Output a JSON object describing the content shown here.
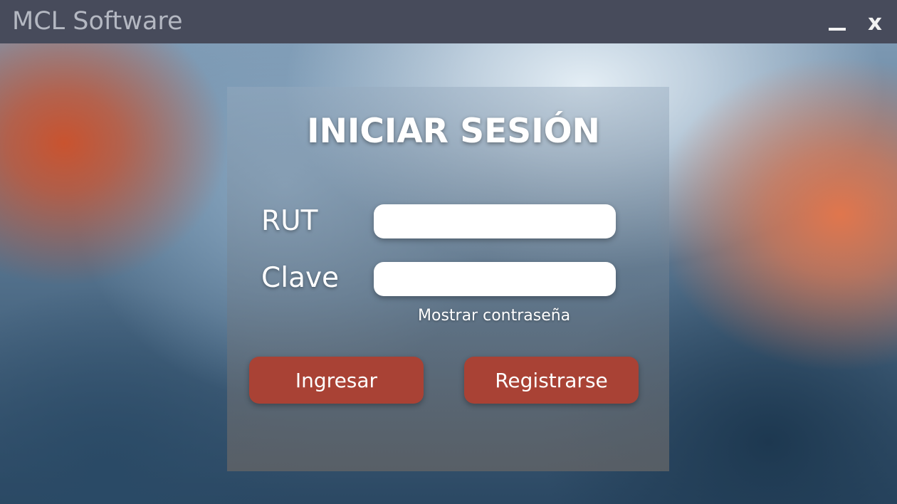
{
  "window": {
    "title": "MCL Software",
    "minimize_icon": "minimize-icon",
    "close_label": "x"
  },
  "login": {
    "heading": "INICIAR SESIÓN",
    "rut_label": "RUT",
    "rut_value": "",
    "password_label": "Clave",
    "password_value": "",
    "show_password_label": "Mostrar contraseña",
    "login_button_label": "Ingresar",
    "register_button_label": "Registrarse"
  },
  "colors": {
    "titlebar": "#474b5b",
    "button_accent": "#a94235",
    "panel_text": "#ffffff"
  }
}
